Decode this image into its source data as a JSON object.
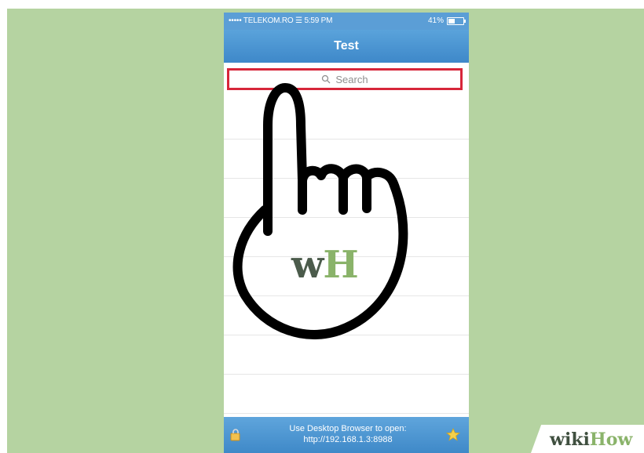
{
  "status_bar": {
    "carrier": "••••• TELEKOM.RO",
    "time": "5:59 PM",
    "battery": "41%"
  },
  "nav": {
    "title": "Test"
  },
  "search": {
    "placeholder": "Search"
  },
  "list": {
    "rows": 8
  },
  "bottom_bar": {
    "line1": "Use Desktop Browser to open:",
    "line2": "http://192.168.1.3:8988"
  },
  "overlay": {
    "logo_w": "w",
    "logo_h": "H"
  },
  "watermark": {
    "wiki": "wiki",
    "how": "How"
  },
  "colors": {
    "background": "#b5d3a1",
    "accent": "#4a94d2",
    "highlight": "#d7263a",
    "brand_green": "#8ab36a"
  }
}
